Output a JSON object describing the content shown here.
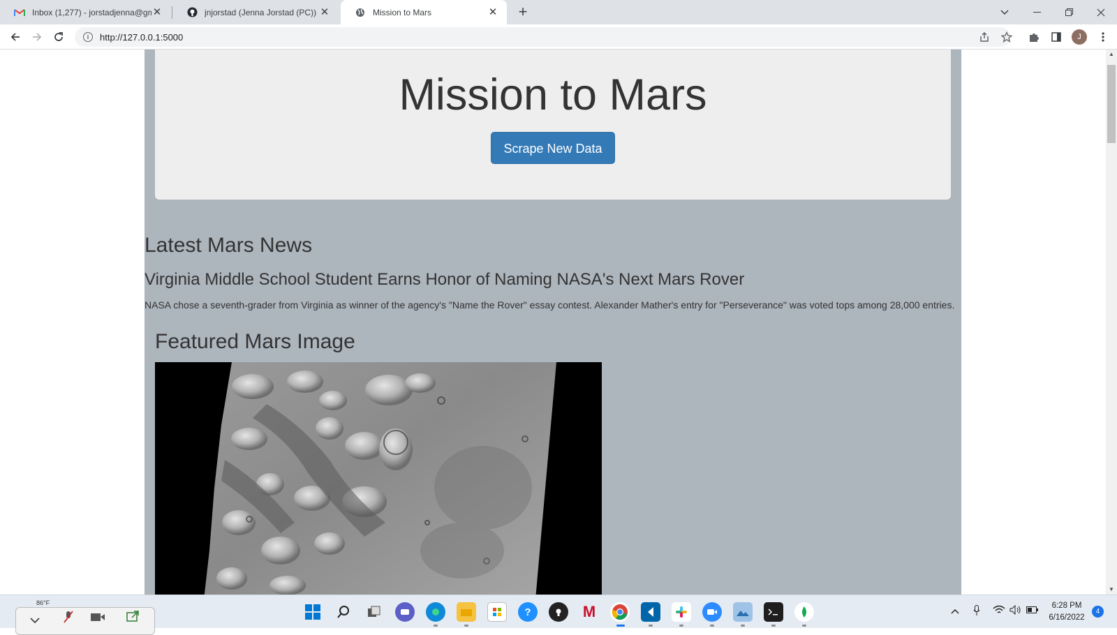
{
  "browser": {
    "tabs": [
      {
        "title": "Inbox (1,277) - jorstadjenna@gm",
        "icon": "gmail-icon",
        "active": false
      },
      {
        "title": "jnjorstad (Jenna Jorstad (PC))",
        "icon": "github-icon",
        "active": false
      },
      {
        "title": "Mission to Mars",
        "icon": "globe-icon",
        "active": true
      }
    ],
    "new_tab_glyph": "+",
    "url": "http://127.0.0.1:5000",
    "profile_initial": "J"
  },
  "page": {
    "heading": "Mission to Mars",
    "scrape_button": "Scrape New Data",
    "news": {
      "section_title": "Latest Mars News",
      "headline": "Virginia Middle School Student Earns Honor of Naming NASA's Next Mars Rover",
      "paragraph": "NASA chose a seventh-grader from Virginia as winner of the agency's \"Name the Rover\" essay contest. Alexander Mather's entry for \"Perseverance\" was voted tops among 28,000 entries."
    },
    "featured": {
      "section_title": "Featured Mars Image"
    }
  },
  "taskbar": {
    "weather": "86°F",
    "time": "6:28 PM",
    "date": "6/16/2022",
    "notification_count": "4"
  },
  "colors": {
    "container_bg": "#adb5bd",
    "jumbotron_bg": "#eeeeee",
    "button_primary": "#337ab7"
  }
}
